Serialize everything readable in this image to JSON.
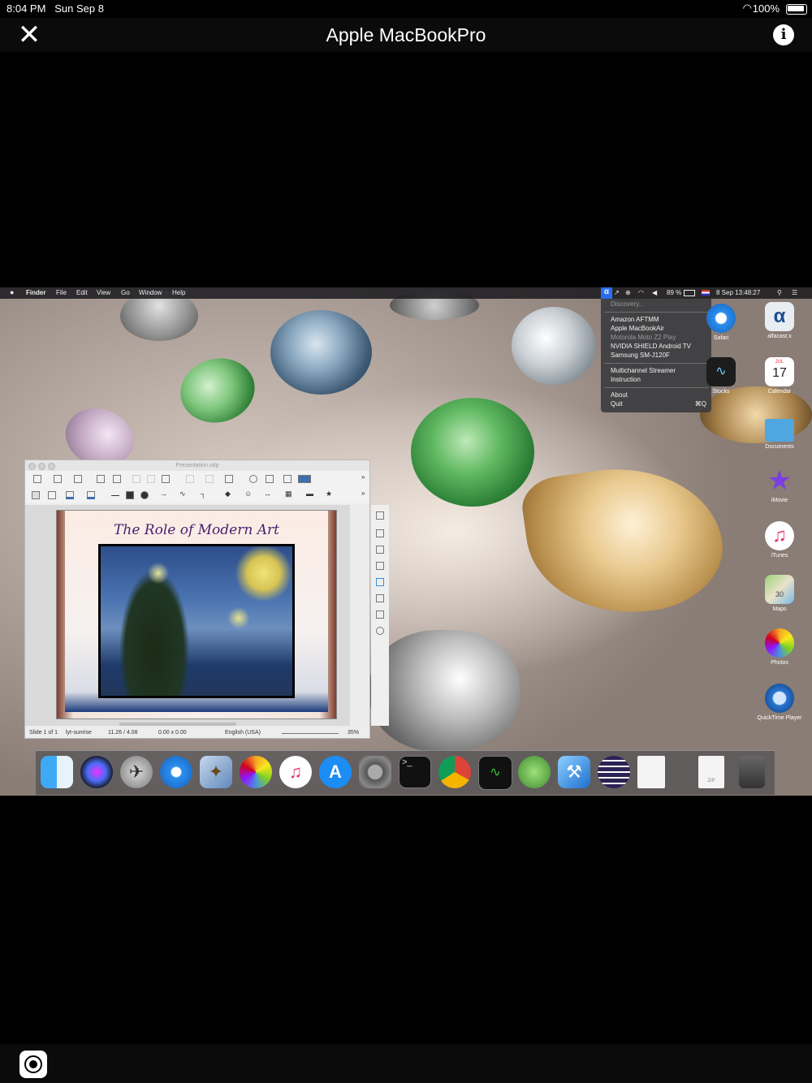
{
  "ios_status": {
    "time": "8:04 PM",
    "date": "Sun Sep 8",
    "battery": "100%"
  },
  "header": {
    "title": "Apple  MacBookPro"
  },
  "mac": {
    "menubar": {
      "app": "Finder",
      "items": [
        "File",
        "Edit",
        "View",
        "Go",
        "Window",
        "Help"
      ],
      "battery": "89 %",
      "datetime": "8 Sep  13:48:27"
    },
    "alfa_menu": {
      "discovery": "Discovery...",
      "devices": [
        "Amazon AFTMM",
        "Apple MacBookAir",
        "Motorola Moto Z2 Play",
        "NVIDIA SHIELD Android TV",
        "Samsung SM-J120F"
      ],
      "multichannel": "Multichannel Streamer",
      "instruction": "Instruction",
      "about": "About",
      "quit": "Quit",
      "quit_shortcut": "⌘Q"
    },
    "desktop_icons": [
      {
        "label": "Safari",
        "icon": "safari-icon"
      },
      {
        "label": "alfacast x",
        "icon": "alfacast-icon"
      },
      {
        "label": "Stocks",
        "icon": "stocks-icon"
      },
      {
        "label": "Calendar",
        "icon": "calendar-icon",
        "month": "JUL",
        "day": "17"
      },
      {
        "label": "Documents",
        "icon": "folder-icon"
      },
      {
        "label": "iMovie",
        "icon": "imovie-icon"
      },
      {
        "label": "iTunes",
        "icon": "itunes-icon"
      },
      {
        "label": "Maps",
        "icon": "maps-icon",
        "badge": "30"
      },
      {
        "label": "Photos",
        "icon": "photos-icon"
      },
      {
        "label": "QuickTime Player",
        "icon": "quicktime-icon"
      }
    ],
    "impress": {
      "title": "Presentation.odp",
      "slide_title": "The Role of Modern Art",
      "status": {
        "slide": "Slide 1 of 1",
        "layout": "lyt-sunrise",
        "position": "11.26 / 4.08",
        "size": "0.00 x 0.00",
        "language": "English (USA)",
        "zoom": "35%"
      }
    },
    "dock": [
      "finder-icon",
      "siri-icon",
      "launchpad-icon",
      "safari-icon",
      "preview-icon",
      "photos-icon",
      "itunes-icon",
      "app-store-icon",
      "system-preferences-icon",
      "terminal-icon",
      "chrome-icon",
      "activity-monitor-icon",
      "android-studio-icon",
      "xcode-icon",
      "eclipse-icon",
      "document-icon",
      "zip-file-icon",
      "trash-icon"
    ],
    "dock_labels": {
      "zip": "ZIP"
    }
  },
  "colors": {
    "accent": "#0a84ff",
    "header_bg": "#0b0b0b",
    "screen_bg": "#000000"
  }
}
